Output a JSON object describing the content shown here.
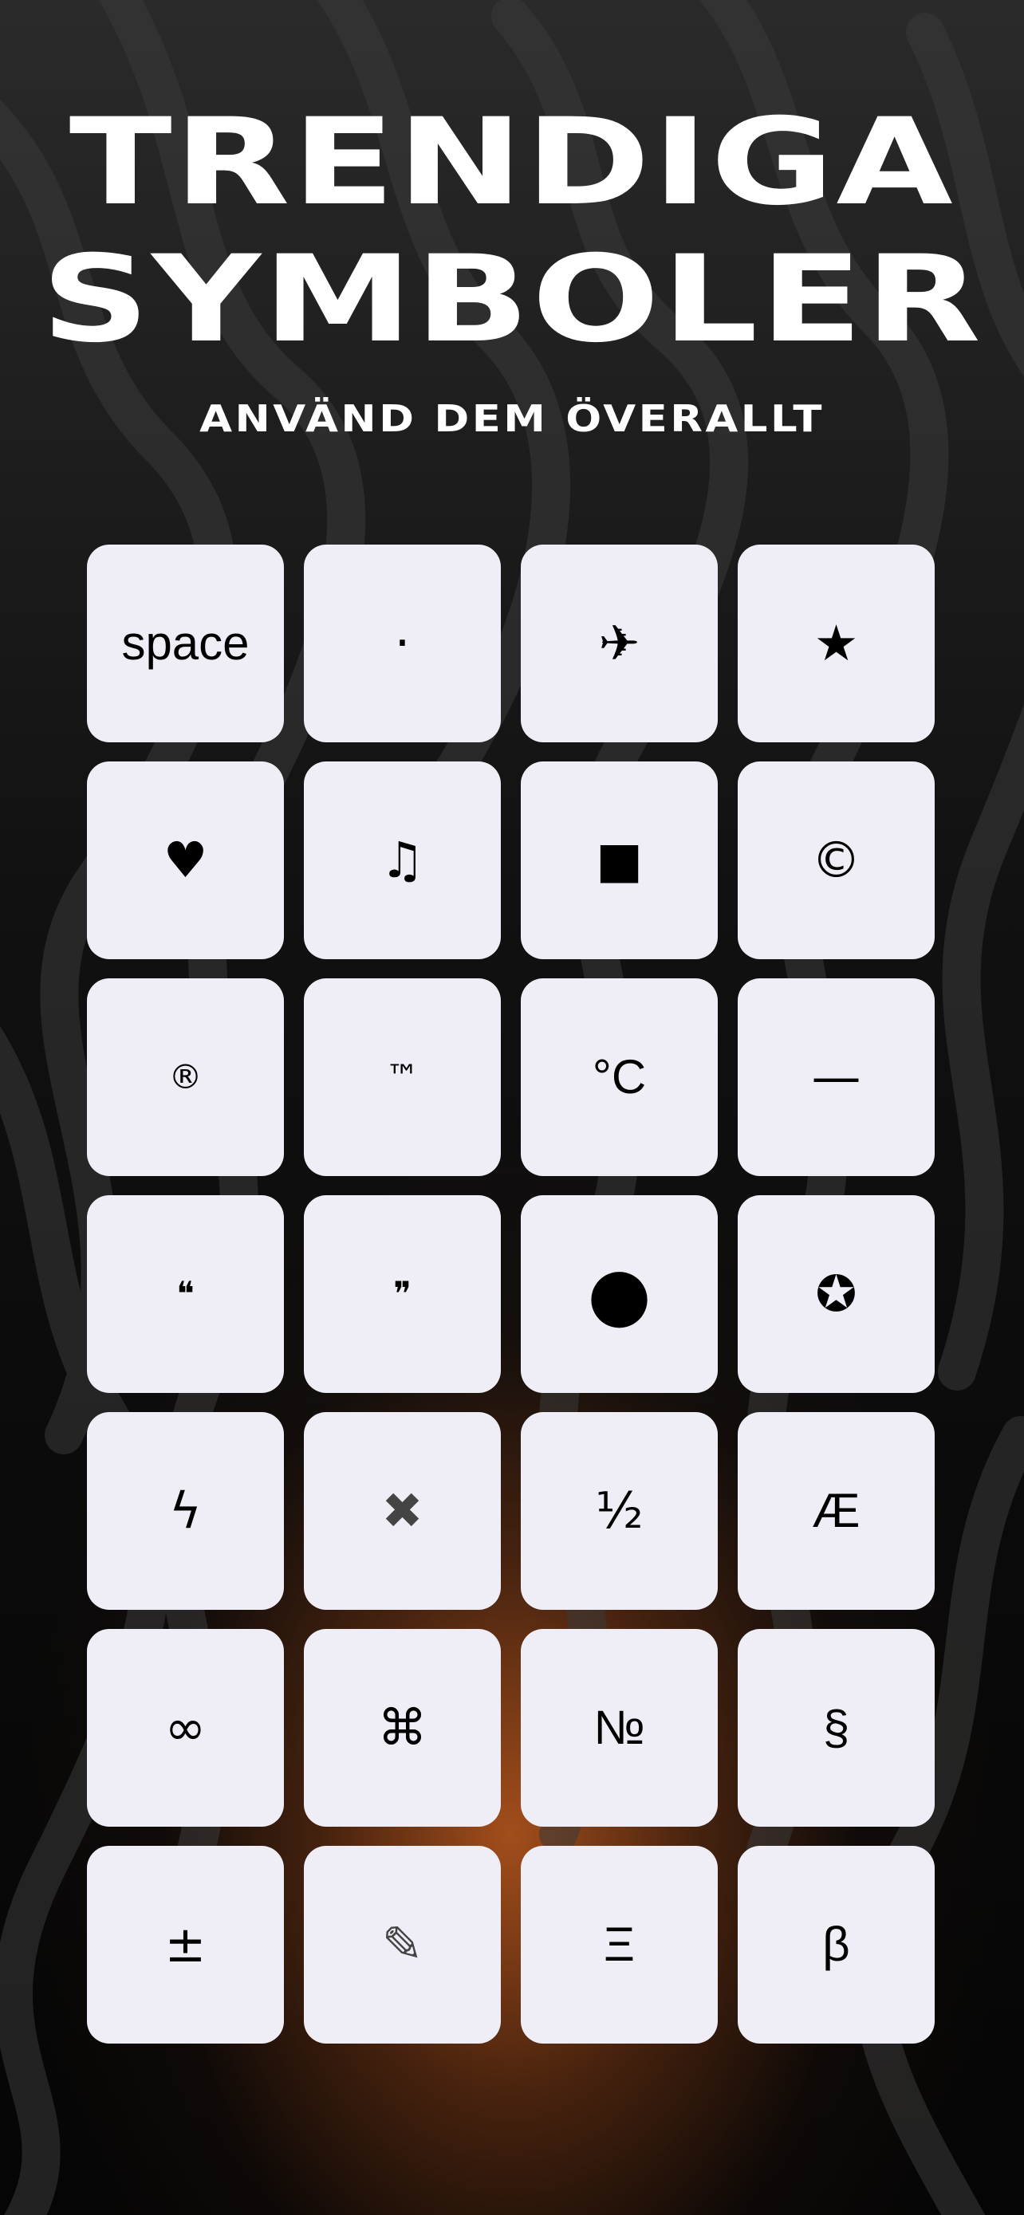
{
  "header": {
    "title_line_1": "TRENDIGA",
    "title_line_2": "SYMBOLER",
    "subtitle": "ANVÄND DEM ÖVERALLT"
  },
  "symbols": [
    {
      "label": "space",
      "name": "space"
    },
    {
      "label": "·",
      "name": "middle-dot"
    },
    {
      "label": "✈",
      "name": "airplane"
    },
    {
      "label": "★",
      "name": "star"
    },
    {
      "label": "♥",
      "name": "heart"
    },
    {
      "label": "♫",
      "name": "music-notes"
    },
    {
      "label": "■",
      "name": "black-square"
    },
    {
      "label": "©",
      "name": "copyright"
    },
    {
      "label": "®",
      "name": "registered"
    },
    {
      "label": "™",
      "name": "trademark"
    },
    {
      "label": "°C",
      "name": "degree-celsius"
    },
    {
      "label": "—",
      "name": "em-dash"
    },
    {
      "label": "❝",
      "name": "open-quote"
    },
    {
      "label": "❞",
      "name": "close-quote"
    },
    {
      "label": "●",
      "name": "black-circle"
    },
    {
      "label": "✪",
      "name": "circled-star"
    },
    {
      "label": "ϟ",
      "name": "lightning"
    },
    {
      "label": "✖",
      "name": "heavy-x"
    },
    {
      "label": "½",
      "name": "one-half"
    },
    {
      "label": "Æ",
      "name": "ae-ligature"
    },
    {
      "label": "∞",
      "name": "infinity"
    },
    {
      "label": "⌘",
      "name": "command"
    },
    {
      "label": "№",
      "name": "numero"
    },
    {
      "label": "§",
      "name": "section"
    },
    {
      "label": "±",
      "name": "plus-minus"
    },
    {
      "label": "✎",
      "name": "pencil"
    },
    {
      "label": "Ξ",
      "name": "xi"
    },
    {
      "label": "β",
      "name": "beta"
    }
  ],
  "colors": {
    "key_background": "#efeef6",
    "glow": "#be5a1e",
    "text": "#ffffff"
  }
}
